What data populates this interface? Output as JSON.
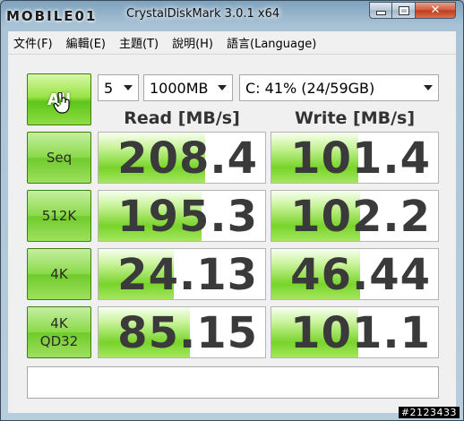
{
  "window": {
    "title": "CrystalDiskMark 3.0.1 x64",
    "watermark": "MOBILE01"
  },
  "menu": [
    "文件(F)",
    "編輯(E)",
    "主題(T)",
    "說明(H)",
    "語言(Language)"
  ],
  "controls": {
    "all_button_label": "All",
    "runs": "5",
    "size": "1000MB",
    "drive": "C: 41% (24/59GB)"
  },
  "headers": {
    "read": "Read [MB/s]",
    "write": "Write [MB/s]"
  },
  "rows": [
    {
      "label1": "Seq",
      "label2": "",
      "read": "208.4",
      "write": "101.4",
      "read_fill": 0.64,
      "write_fill": 0.52
    },
    {
      "label1": "512K",
      "label2": "",
      "read": "195.3",
      "write": "102.2",
      "read_fill": 0.62,
      "write_fill": 0.53
    },
    {
      "label1": "4K",
      "label2": "",
      "read": "24.13",
      "write": "46.44",
      "read_fill": 0.45,
      "write_fill": 0.53
    },
    {
      "label1": "4K",
      "label2": "QD32",
      "read": "85.15",
      "write": "101.1",
      "read_fill": 0.55,
      "write_fill": 0.52
    }
  ],
  "status_text": "",
  "badge": "#2123433",
  "colors": {
    "button_green": "#6fcb2a",
    "value_text": "#3a3a3a"
  }
}
